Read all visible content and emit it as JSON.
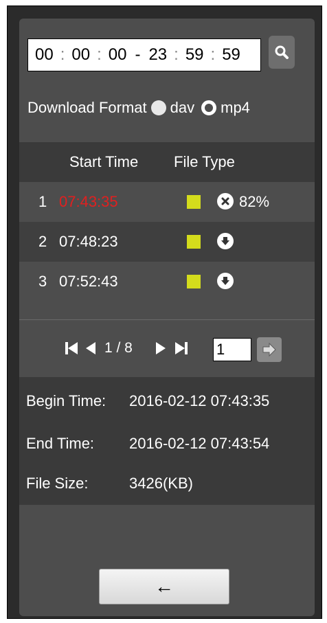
{
  "time_range": {
    "start_h": "00",
    "start_m": "00",
    "start_s": "00",
    "sep": ":",
    "dash": "-",
    "end_h": "23",
    "end_m": "59",
    "end_s": "59"
  },
  "icons": {
    "search": "search-icon",
    "cancel": "cancel-icon",
    "download": "download-icon",
    "first": "first-page-icon",
    "prev": "prev-page-icon",
    "next": "next-page-icon",
    "last": "last-page-icon",
    "go": "go-arrow-icon",
    "back": "back-arrow-icon"
  },
  "download_format": {
    "label": "Download Format",
    "options": [
      {
        "label": "dav",
        "selected": true
      },
      {
        "label": "mp4",
        "selected": false
      }
    ]
  },
  "table": {
    "headers": {
      "start_time": "Start Time",
      "file_type": "File Type"
    },
    "rows": [
      {
        "num": "1",
        "time": "07:43:35",
        "status": "82%",
        "action": "cancel"
      },
      {
        "num": "2",
        "time": "07:48:23",
        "status": "",
        "action": "download"
      },
      {
        "num": "3",
        "time": "07:52:43",
        "status": "",
        "action": "download"
      }
    ],
    "file_type_color": "#d4dc1c",
    "highlight_color": "#e02020"
  },
  "pager": {
    "page_label": "1 / 8",
    "page_input": "1"
  },
  "info": {
    "begin_label": "Begin Time:",
    "begin_value": "2016-02-12 07:43:35",
    "end_label": "End Time:",
    "end_value": "2016-02-12 07:43:54",
    "size_label": "File Size:",
    "size_value": "3426(KB)"
  },
  "back_button": {
    "label": "←"
  }
}
